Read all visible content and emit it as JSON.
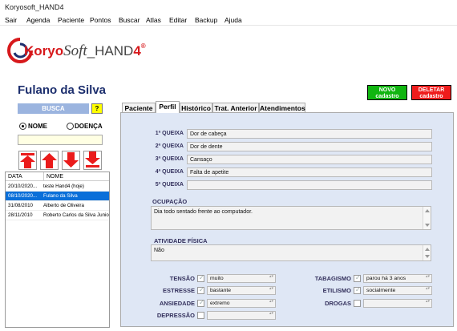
{
  "window": {
    "title": "Koryosoft_HAND4"
  },
  "menu": [
    "Sair",
    "Agenda",
    "Paciente",
    "Pontos",
    "Buscar",
    "Atlas",
    "Editar",
    "Backup",
    "Ajuda"
  ],
  "logo": {
    "brand_bold": "Koryo",
    "brand_italic": "Soft",
    "brand_suffix": "_HAND",
    "brand_digit": "4",
    "registered": "®",
    "mark_text": "고려",
    "mark_color": "#d7191c"
  },
  "patient": {
    "name": "Fulano da Silva"
  },
  "actions": {
    "new_line1": "NOVO",
    "new_line2": "cadastro",
    "delete_line1": "DELETAR",
    "delete_line2": "cadastro"
  },
  "search": {
    "label": "BUSCA",
    "help": "?",
    "option_name": "NOME",
    "option_disease": "DOENÇA",
    "value": ""
  },
  "arrows": [
    "first-icon",
    "up-icon",
    "down-icon",
    "last-icon"
  ],
  "list": {
    "headers": [
      "DATA",
      "NOME"
    ],
    "rows": [
      {
        "date": "20/10/2020...",
        "name": "teste Hand4 (hoje)"
      },
      {
        "date": "08/10/2020...",
        "name": "Fulano da Silva"
      },
      {
        "date": "31/08/2010",
        "name": "Alberto de Oliveira"
      },
      {
        "date": "28/11/2010",
        "name": "Roberto Carlos da Silva Junio"
      }
    ]
  },
  "tabs": [
    "Paciente",
    "Perfil",
    "Histórico",
    "Trat. Anterior",
    "Atendimentos"
  ],
  "profile": {
    "complaints": [
      {
        "label": "1ª QUEIXA",
        "value": "Dor de cabeça"
      },
      {
        "label": "2ª QUEIXA",
        "value": "Dor de dente"
      },
      {
        "label": "3ª QUEIXA",
        "value": "Cansaço"
      },
      {
        "label": "4ª QUEIXA",
        "value": "Falta de apetite"
      },
      {
        "label": "5ª QUEIXA",
        "value": ""
      }
    ],
    "occupation_label": "OCUPAÇÃO",
    "occupation_value": "Dia todo sentado frente ao computador.",
    "activity_label": "ATIVIDADE  FÍSICA",
    "activity_value": "Não",
    "left_status": [
      {
        "label": "TENSÃO",
        "value": "muito",
        "checked": true
      },
      {
        "label": "ESTRESSE",
        "value": "bastante",
        "checked": true
      },
      {
        "label": "ANSIEDADE",
        "value": "extremo",
        "checked": true
      },
      {
        "label": "DEPRESSÃO",
        "value": "",
        "checked": false
      }
    ],
    "right_status": [
      {
        "label": "TABAGISMO",
        "value": "parou há 3 anos",
        "checked": true
      },
      {
        "label": "ETILISMO",
        "value": "socialmente",
        "checked": true
      },
      {
        "label": "DROGAS",
        "value": "",
        "checked": false
      }
    ]
  },
  "colors": {
    "accent_blue": "#0a6fd9",
    "panel_bg": "#dfe7f5",
    "new_green": "#10b510",
    "delete_red": "#ef1c1c",
    "arrow_red": "#ea1b1b",
    "name_color": "#1d2f6e"
  }
}
